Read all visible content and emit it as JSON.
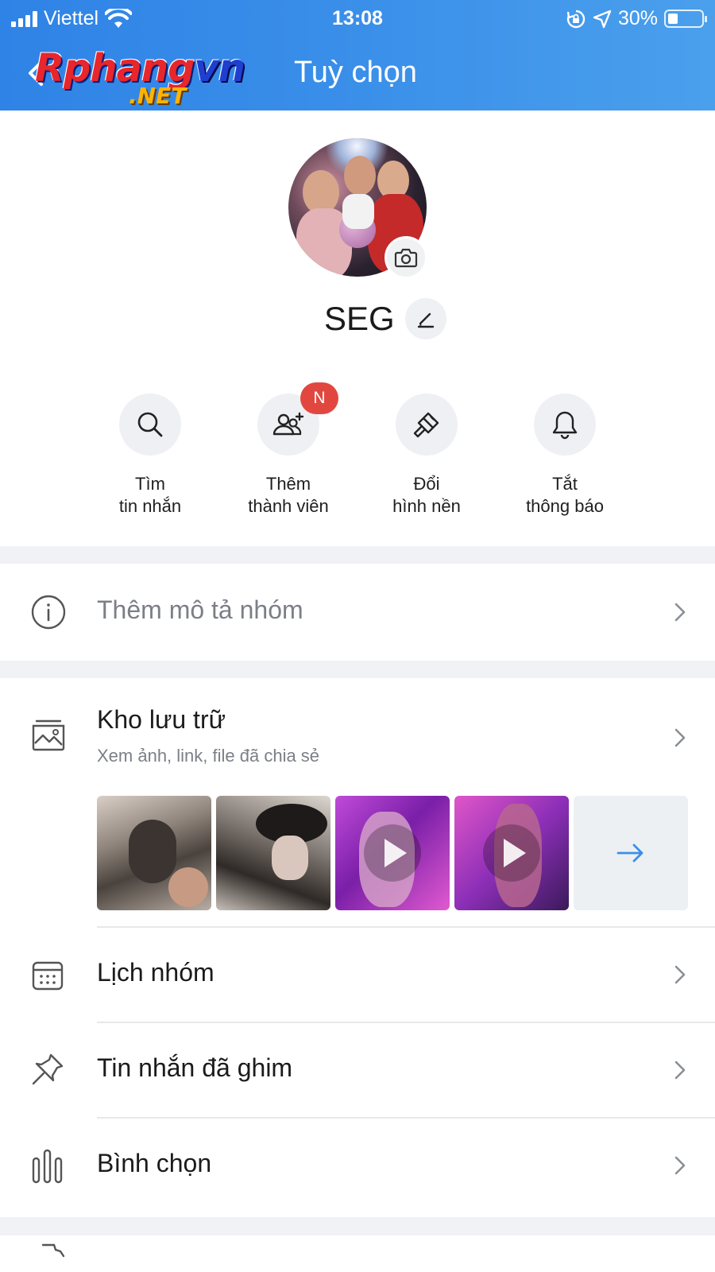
{
  "status_bar": {
    "carrier": "Viettel",
    "time": "13:08",
    "battery_percent": "30%",
    "battery_level": 0.3
  },
  "header": {
    "logo_text_main": "Rphang",
    "logo_text_vn": "vn",
    "logo_text_net": ".NET",
    "title": "Tuỳ chọn"
  },
  "group": {
    "name": "SEG"
  },
  "quick_actions": [
    {
      "line1": "Tìm",
      "line2": "tin nhắn",
      "icon": "search-icon"
    },
    {
      "line1": "Thêm",
      "line2": "thành viên",
      "icon": "add-member-icon",
      "badge": "N"
    },
    {
      "line1": "Đổi",
      "line2": "hình nền",
      "icon": "paint-brush-icon"
    },
    {
      "line1": "Tắt",
      "line2": "thông báo",
      "icon": "bell-icon"
    }
  ],
  "description_row": {
    "label": "Thêm mô tả nhóm",
    "icon": "info-icon"
  },
  "storage_row": {
    "title": "Kho lưu trữ",
    "subtitle": "Xem ảnh, link, file đã chia sẻ",
    "icon": "gallery-folder-icon",
    "thumbnails": [
      {
        "kind": "image"
      },
      {
        "kind": "image"
      },
      {
        "kind": "video"
      },
      {
        "kind": "video"
      }
    ]
  },
  "menu_rows": [
    {
      "label": "Lịch nhóm",
      "icon": "calendar-icon"
    },
    {
      "label": "Tin nhắn đã ghim",
      "icon": "pin-icon"
    },
    {
      "label": "Bình chọn",
      "icon": "poll-icon"
    }
  ],
  "colors": {
    "header_blue": "#2f83e6",
    "badge_red": "#e2473f",
    "arrow_blue": "#3a8fe9",
    "secondary_text": "#7b7f86"
  }
}
